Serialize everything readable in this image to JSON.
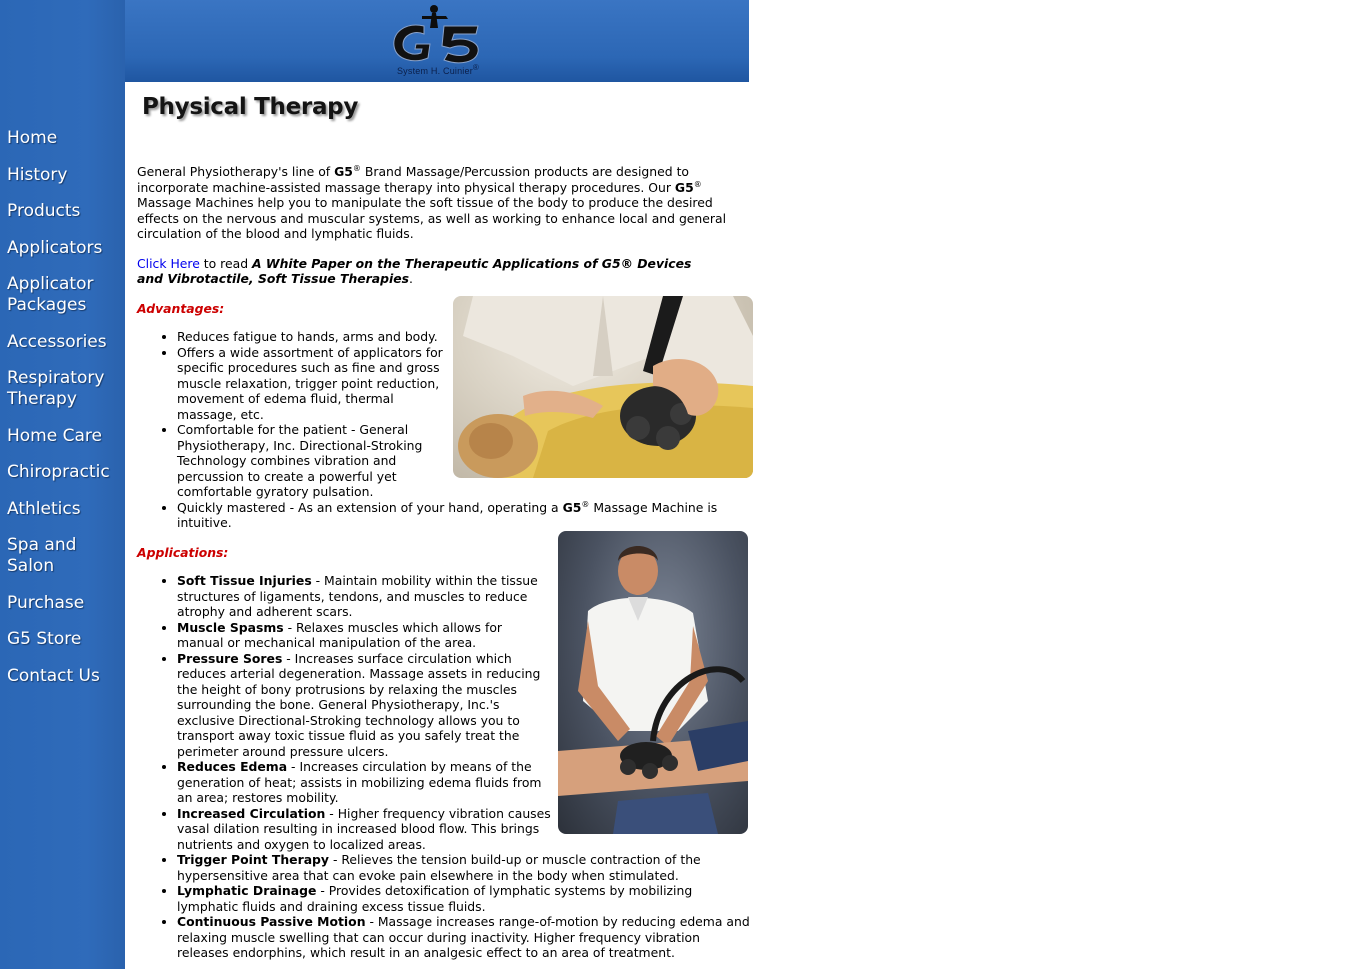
{
  "logo": {
    "caption": "System H. Cuinier",
    "mark": "G5"
  },
  "nav": [
    "Home",
    "History",
    "Products",
    "Applicators",
    "Applicator\nPackages",
    "Accessories",
    "Respiratory\nTherapy",
    "Home Care",
    "Chiropractic",
    "Athletics",
    "Spa and Salon",
    "Purchase",
    "G5 Store",
    "Contact Us"
  ],
  "page": {
    "title": "Physical Therapy",
    "intro": {
      "p1": "General Physiotherapy's line of ",
      "g5": "G5",
      "reg": "®",
      "p2": " Brand Massage/Percussion products are designed to incorporate machine-assisted massage therapy into physical therapy procedures. Our ",
      "p3": " Massage Machines help you to manipulate the soft tissue of the body to produce the desired effects on the nervous and muscular systems, as well as working to enhance local and general circulation of the blood and lymphatic fluids."
    },
    "whitepaper": {
      "link": "Click Here",
      "text": " to read ",
      "title": "A White Paper on the Therapeutic Applications of G5® Devices and Vibrotactile, Soft Tissue Therapies",
      "end": "."
    },
    "advantages_heading": "Advantages:",
    "advantages": [
      "Reduces fatigue to hands, arms and body.",
      "Offers a wide assortment of applicators for specific procedures such as fine and gross muscle relaxation, trigger point reduction, movement of edema fluid, thermal massage, etc.",
      "Comfortable for the patient - General Physiotherapy, Inc. Directional-Stroking Technology combines vibration and percussion to create a powerful yet comfortable gyratory pulsation."
    ],
    "advantage_last": {
      "pre": "Quickly mastered - As an extension of your hand, operating a ",
      "g5": "G5",
      "reg": "®",
      "post": " Massage Machine is intuitive."
    },
    "applications_heading": "Applications:",
    "applications": [
      {
        "term": "Soft Tissue Injuries",
        "desc": " - Maintain mobility within the tissue structures of ligaments, tendons, and muscles to reduce atrophy and adherent scars."
      },
      {
        "term": "Muscle Spasms",
        "desc": " - Relaxes muscles which allows for manual or mechanical manipulation of the area."
      },
      {
        "term": "Pressure Sores",
        "desc": " - Increases surface circulation which reduces arterial degeneration. Massage assets in reducing the height of bony protrusions by relaxing the muscles surrounding the bone. General Physiotherapy, Inc.'s exclusive Directional-Stroking technology allows you to transport away toxic tissue fluid as you safely treat the perimeter around pressure ulcers."
      },
      {
        "term": "Reduces Edema",
        "desc": " - Increases circulation by means of the generation of heat; assists in mobilizing edema fluids from an area; restores mobility."
      },
      {
        "term": "Increased Circulation",
        "desc": " - Higher frequency vibration causes vasal dilation resulting in increased blood flow. This brings nutrients and oxygen to localized areas."
      },
      {
        "term": "Trigger Point Therapy",
        "desc": " - Relieves the tension build-up or muscle contraction of the hypersensitive area that can evoke pain elsewhere in the body when stimulated."
      },
      {
        "term": "Lymphatic Drainage",
        "desc": " - Provides detoxification of lymphatic systems by mobilizing lymphatic fluids and draining excess tissue fluids."
      },
      {
        "term": "Continuous Passive Motion",
        "desc": " - Massage increases range-of-motion by reducing edema and relaxing muscle swelling that can occur during inactivity. Higher frequency vibration releases endorphins, which result in an analgesic effect to an area of treatment."
      }
    ]
  },
  "colors": {
    "sidebar": "#2b67b6",
    "heading_red": "#cc0000",
    "link": "#0000ee"
  }
}
